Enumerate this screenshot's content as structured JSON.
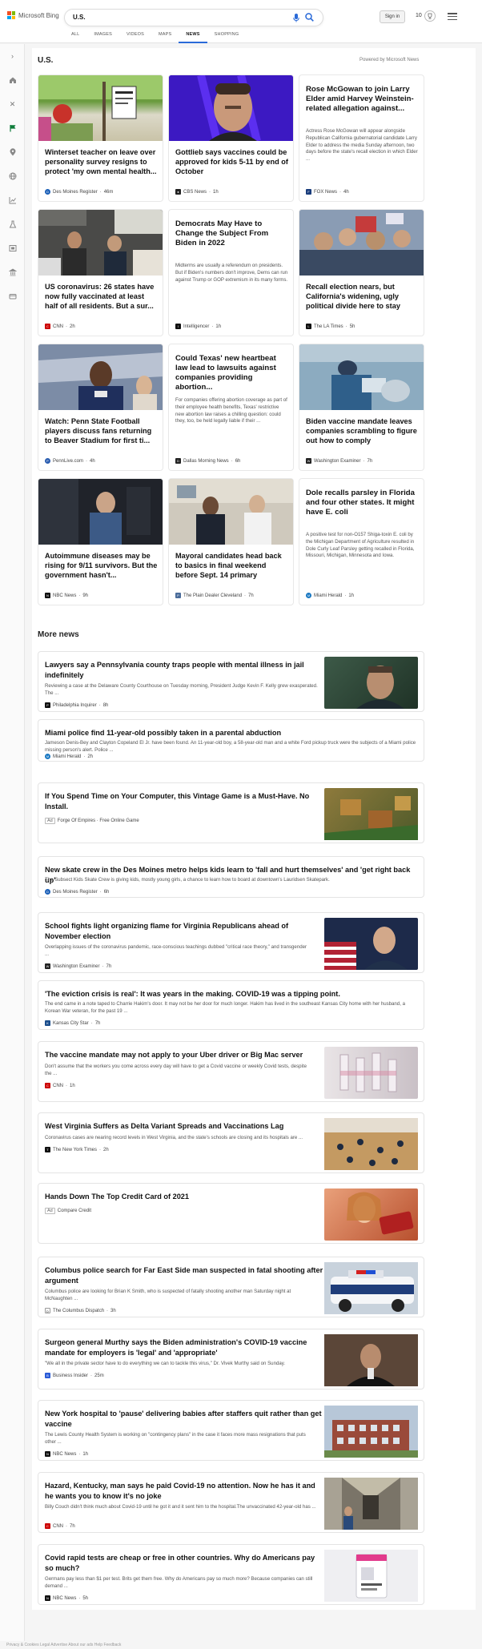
{
  "header": {
    "brand": "Microsoft Bing",
    "query": "U.S.",
    "signin_label": "Sign in",
    "points": "10",
    "logo_colors": [
      "#f25022",
      "#7fba00",
      "#00a4ef",
      "#ffb900"
    ]
  },
  "nav": [
    "ALL",
    "IMAGES",
    "VIDEOS",
    "MAPS",
    "NEWS",
    "SHOPPING"
  ],
  "section": {
    "title": "U.S.",
    "powered": "Powered by Microsoft News"
  },
  "cards": [
    {
      "title": "Winterset teacher on leave over personality survey resigns to protect 'my own mental health...",
      "source": "Des Moines Register",
      "age": "46m"
    },
    {
      "title": "Gottlieb says vaccines could be approved for kids 5-11 by end of October",
      "source": "CBS News",
      "age": "1h"
    },
    {
      "title": "Rose McGowan to join Larry Elder amid Harvey Weinstein-related allegation against...",
      "snippet": "Actress Rose McGowan will appear alongside Republican California gubernatorial candidate Larry Elder to address the media Sunday afternoon, two days before the state's recall election in which Elder ...",
      "source": "FOX News",
      "age": "4h"
    },
    {
      "title": "US coronavirus: 26 states have now fully vaccinated at least half of all residents. But a sur...",
      "source": "CNN",
      "age": "2h"
    },
    {
      "title": "Democrats May Have to Change the Subject From Biden in 2022",
      "snippet": "Midterms are usually a referendum on presidents. But if Biden's numbers don't improve, Dems can run against Trump or GOP extremism in its many forms.",
      "source": "Intelligencer",
      "age": "1h"
    },
    {
      "title": "Recall election nears, but California's widening, ugly political divide here to stay",
      "source": "The LA Times",
      "age": "5h"
    },
    {
      "title": "Watch: Penn State Football players discuss fans returning to Beaver Stadium for first ti...",
      "source": "PennLive.com",
      "age": "4h"
    },
    {
      "title": "Could Texas' new heartbeat law lead to lawsuits against companies providing abortion...",
      "snippet": "For companies offering abortion coverage as part of their employee health benefits, Texas' restrictive new abortion law raises a chilling question: could they, too, be held legally liable if their ...",
      "source": "Dallas Morning News",
      "age": "6h"
    },
    {
      "title": "Biden vaccine mandate leaves companies scrambling to figure out how to comply",
      "source": "Washington Examiner",
      "age": "7h"
    },
    {
      "title": "Autoimmune diseases may be rising for 9/11 survivors. But the government hasn't...",
      "source": "NBC News",
      "age": "9h"
    },
    {
      "title": "Mayoral candidates head back to basics in final weekend before Sept. 14 primary",
      "source": "The Plain Dealer Cleveland",
      "age": "7h"
    },
    {
      "title": "Dole recalls parsley in Florida and four other states. It might have E. coli",
      "snippet": "A positive test for non-O157 Shiga-toxin E. coli by the Michigan Department of Agriculture resulted in Dole Curly Leaf Parsley getting recalled in Florida, Missouri, Michigan, Minnesota and Iowa.",
      "source": "Miami Herald",
      "age": "1h"
    }
  ],
  "more": {
    "title": "More news",
    "items": [
      {
        "title": "Lawyers say a Pennsylvania county traps people with mental illness in jail indefinitely",
        "snippet": "Reviewing a case at the Delaware County Courthouse on Tuesday morning, President Judge Kevin F. Kelly grew exasperated. The ...",
        "source": "Philadelphia Inquirer",
        "age": "8h"
      },
      {
        "title": "Miami police find 11-year-old possibly taken in a parental abduction",
        "snippet": "Jameson Denis-Bey and Clayton Copeland El Jr. have been found. An 11-year-old boy, a 58-year-old man and a white Ford pickup truck were the subjects of a Miami police missing person's alert. Police ...",
        "source": "Miami Herald",
        "age": "2h"
      },
      {
        "title": "If You Spend Time on Your Computer, this Vintage Game is a Must-Have. No Install.",
        "ad": "Ad",
        "source": "Forge Of Empires · Free Online Game",
        "age": ""
      },
      {
        "title": "New skate crew in the Des Moines metro helps kids learn to 'fall and hurt themselves' and 'get right back up'",
        "snippet": "The Subsect Kids Skate Crew is giving kids, mostly young girls, a chance to learn how to board at downtown's Lauridsen Skatepark.",
        "source": "Des Moines Register",
        "age": "6h"
      },
      {
        "title": "School fights light organizing flame for Virginia Republicans ahead of November election",
        "snippet": "Overlapping issues of the coronavirus pandemic, race-conscious teachings dubbed \"critical race theory,\" and transgender ...",
        "source": "Washington Examiner",
        "age": "7h"
      },
      {
        "title": "'The eviction crisis is real': It was years in the making. COVID-19 was a tipping point.",
        "snippet": "The end came in a note taped to Charrie Hakim's door. It may not be her door for much longer. Hakim has lived in the southeast Kansas City home with her husband, a Korean War veteran, for the past 19 ...",
        "source": "Kansas City Star",
        "age": "7h"
      },
      {
        "title": "The vaccine mandate may not apply to your Uber driver or Big Mac server",
        "snippet": "Don't assume that the workers you come across every day will have to get a Covid vaccine or weekly Covid tests, despite the ...",
        "source": "CNN",
        "age": "1h"
      },
      {
        "title": "West Virginia Suffers as Delta Variant Spreads and Vaccinations Lag",
        "snippet": "Coronavirus cases are nearing record levels in West Virginia, and the state's schools are closing and its hospitals are ...",
        "source": "The New York Times",
        "age": "2h"
      },
      {
        "title": "Hands Down The Top Credit Card of 2021",
        "ad": "Ad",
        "source": "Compare Credit",
        "age": ""
      },
      {
        "title": "Columbus police search for Far East Side man suspected in fatal shooting after argument",
        "snippet": "Columbus police are looking for Brian K Smith, who is suspected of fatally shooting another man Saturday night at McNaughten ...",
        "source": "The Columbus Dispatch",
        "age": "3h"
      },
      {
        "title": "Surgeon general Murthy says the Biden administration's COVID-19 vaccine mandate for employers is 'legal' and 'appropriate'",
        "snippet": "\"We all in the private sector have to do everything we can to tackle this virus,\" Dr. Vivek Murthy said on Sunday.",
        "source": "Business Insider",
        "age": "25m"
      },
      {
        "title": "New York hospital to 'pause' delivering babies after staffers quit rather than get vaccine",
        "snippet": "The Lewis County Health System is working on \"contingency plans\" in the case it faces more mass resignations that puts other ...",
        "source": "NBC News",
        "age": "1h"
      },
      {
        "title": "Hazard, Kentucky, man says he paid Covid-19 no attention. Now he has it and he wants you to know it's no joke",
        "snippet": "Billy Couch didn't think much about Covid-19 until he got it and it sent him to the hospital.The unvaccinated 42-year-old has ...",
        "source": "CNN",
        "age": "7h"
      },
      {
        "title": "Covid rapid tests are cheap or free in other countries. Why do Americans pay so much?",
        "snippet": "Germans pay less than $1 per test. Brits get them free. Why do Americans pay so much more? Because companies can still demand ...",
        "source": "NBC News",
        "age": "5h"
      }
    ]
  },
  "footer": "Privacy & Cookies   Legal   Advertise   About our ads   Help   Feedback"
}
